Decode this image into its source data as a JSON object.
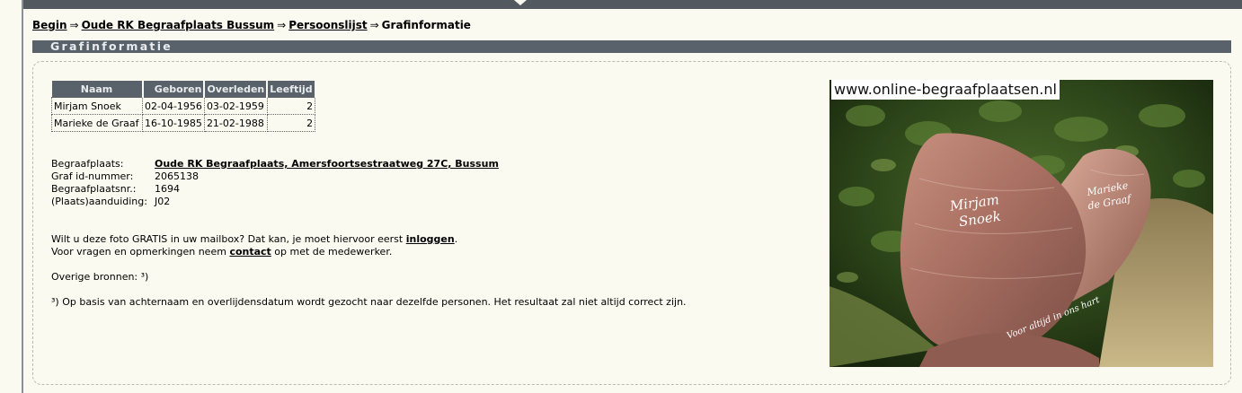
{
  "breadcrumb": {
    "items": [
      "Begin",
      "Oude RK Begraafplaats Bussum",
      "Persoonslijst"
    ],
    "current": "Grafinformatie",
    "separator": "⇒"
  },
  "section": {
    "title": "Grafinformatie"
  },
  "persons": {
    "headers": [
      "Naam",
      "Geboren",
      "Overleden",
      "Leeftijd"
    ],
    "rows": [
      {
        "name": "Mirjam Snoek",
        "born": "02-04-1956",
        "died": "03-02-1959",
        "age": "2"
      },
      {
        "name": "Marieke de Graaf",
        "born": "16-10-1985",
        "died": "21-02-1988",
        "age": "2"
      }
    ]
  },
  "grave": {
    "cemetery_label": "Begraafplaats:",
    "cemetery_value": "Oude RK Begraafplaats, Amersfoortsestraatweg 27C, Bussum",
    "grave_id_label": "Graf id-nummer:",
    "grave_id_value": "2065138",
    "cemetery_nr_label": "Begraafplaatsnr.:",
    "cemetery_nr_value": "1694",
    "location_label": "(Plaats)aanduiding:",
    "location_value": "J02"
  },
  "mail": {
    "line1_prefix": "Wilt u deze foto GRATIS in uw mailbox? Dat kan, je moet hiervoor eerst ",
    "login_link": "inloggen",
    "line1_suffix": ".",
    "line2_prefix": "Voor vragen en opmerkingen neem ",
    "contact_link": "contact",
    "line2_suffix": " op met de medewerker."
  },
  "sources": {
    "label": "Overige bronnen: ³)",
    "footnote": "³) Op basis van achternaam en overlijdensdatum wordt gezocht naar dezelfde personen. Het resultaat zal niet altijd correct zijn."
  },
  "photo": {
    "watermark": "www.online-begraafplaatsen.nl",
    "stone_name_1": "Mirjam",
    "stone_name_2": "Snoek",
    "stone_name_3": "Marieke",
    "stone_name_4": "de Graaf",
    "stone_motto": "Voor altijd in ons hart"
  },
  "colors": {
    "header_bg": "#59626a",
    "page_bg": "#fafaf0"
  }
}
